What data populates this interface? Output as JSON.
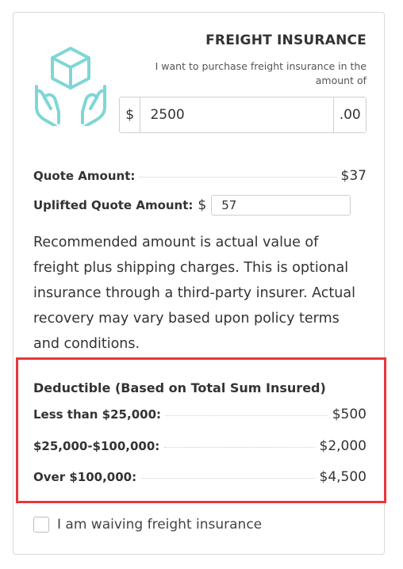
{
  "header": {
    "title": "FREIGHT INSURANCE",
    "subtitle": "I want to purchase freight insurance in the amount of",
    "icon": "box-in-hands-icon"
  },
  "amount": {
    "prefix": "$",
    "value": "2500",
    "suffix": ".00"
  },
  "quote": {
    "label": "Quote Amount:",
    "value": "$37"
  },
  "uplifted": {
    "label": "Uplifted Quote Amount:",
    "currency": "$",
    "value": "57"
  },
  "description": "Recommended amount is actual value of freight plus shipping charges. This is optional insurance through a third-party insurer. Actual recovery may vary based upon policy terms and conditions.",
  "deductible": {
    "heading": "Deductible (Based on Total Sum Insured)",
    "rows": [
      {
        "label": "Less than $25,000:",
        "value": "$500"
      },
      {
        "label": "$25,000-$100,000:",
        "value": "$2,000"
      },
      {
        "label": "Over $100,000:",
        "value": "$4,500"
      }
    ]
  },
  "waive": {
    "label": "I am waiving freight insurance",
    "checked": false
  },
  "colors": {
    "icon": "#7fd6d6",
    "highlight": "#e8363b"
  }
}
